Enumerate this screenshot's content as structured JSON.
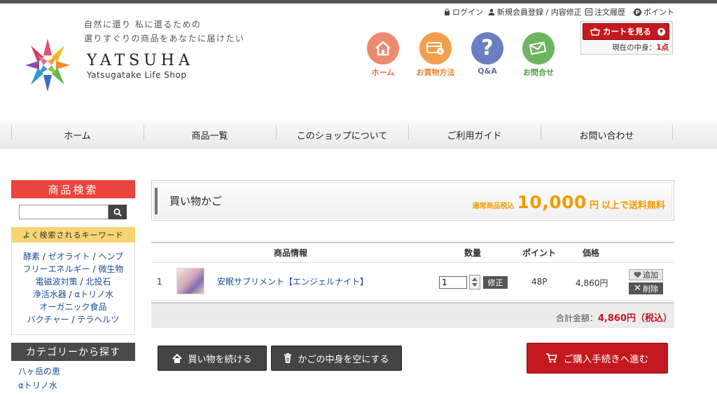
{
  "header": {
    "tagline_1": "自然に還り 私に還るための",
    "tagline_2": "選りすぐりの商品をあなたに届けたい",
    "logo_title": "YATSUHA",
    "logo_sub": "Yatsugatake Life Shop",
    "util": {
      "login": "ログイン",
      "register": "新規会員登録 / 内容修正",
      "history": "注文履歴",
      "points": "ポイント"
    },
    "cart_button": "カートを見る",
    "cart_count_label": "現在の中身：",
    "cart_count_value": "1点",
    "icons": [
      {
        "label": "ホーム",
        "icon": "home-icon",
        "color": "#ee8a6f",
        "label_color": "#e66b4b"
      },
      {
        "label": "お買物方法",
        "icon": "wallet-icon",
        "color": "#f2a04a",
        "label_color": "#e8852a"
      },
      {
        "label": "Q&A",
        "icon": "question-icon",
        "color": "#6a7fc2",
        "label_color": "#5a6fb0"
      },
      {
        "label": "お問合せ",
        "icon": "mail-icon",
        "color": "#6eb463",
        "label_color": "#4e9b43"
      }
    ]
  },
  "nav": {
    "items": [
      "ホーム",
      "商品一覧",
      "このショップについて",
      "ご利用ガイド",
      "お問い合わせ"
    ]
  },
  "sidebar": {
    "search_title": "商品検索",
    "search_value": "",
    "search_color": "#e9453d",
    "keyword_title": "よく検索されるキーワード",
    "keywords": [
      [
        "酵素",
        "ゼオライト",
        "ヘンプ"
      ],
      [
        "フリーエネルギー",
        "微生物"
      ],
      [
        "電磁波対策",
        "北投石"
      ],
      [
        "浄活水器",
        "αトリノ水"
      ],
      [
        "オーガニック食品"
      ],
      [
        "バクチャー",
        "テラヘルツ"
      ]
    ],
    "category_title": "カテゴリーから探す",
    "categories": [
      "八ヶ岳の恵",
      "αトリノ水"
    ]
  },
  "cart": {
    "title": "買い物かご",
    "free_prefix": "通常商品税込",
    "free_amount": "10,000",
    "free_suffix_unit": "円",
    "free_suffix": "以上で送料無料",
    "headers": {
      "info": "商品情報",
      "qty": "数量",
      "point": "ポイント",
      "price": "価格"
    },
    "items": [
      {
        "no": "1",
        "name": "安眠サプリメント【エンジェルナイト】",
        "qty": "1",
        "point": "48P",
        "price": "4,860円"
      }
    ],
    "update_label": "修正",
    "add_label": "追加",
    "delete_label": "削除",
    "total_label": "合計金額：",
    "total_value": "4,860円（税込）"
  },
  "actions": {
    "continue": "買い物を続ける",
    "empty": "かごの中身を空にする",
    "checkout": "ご購入手続きへ進む"
  }
}
